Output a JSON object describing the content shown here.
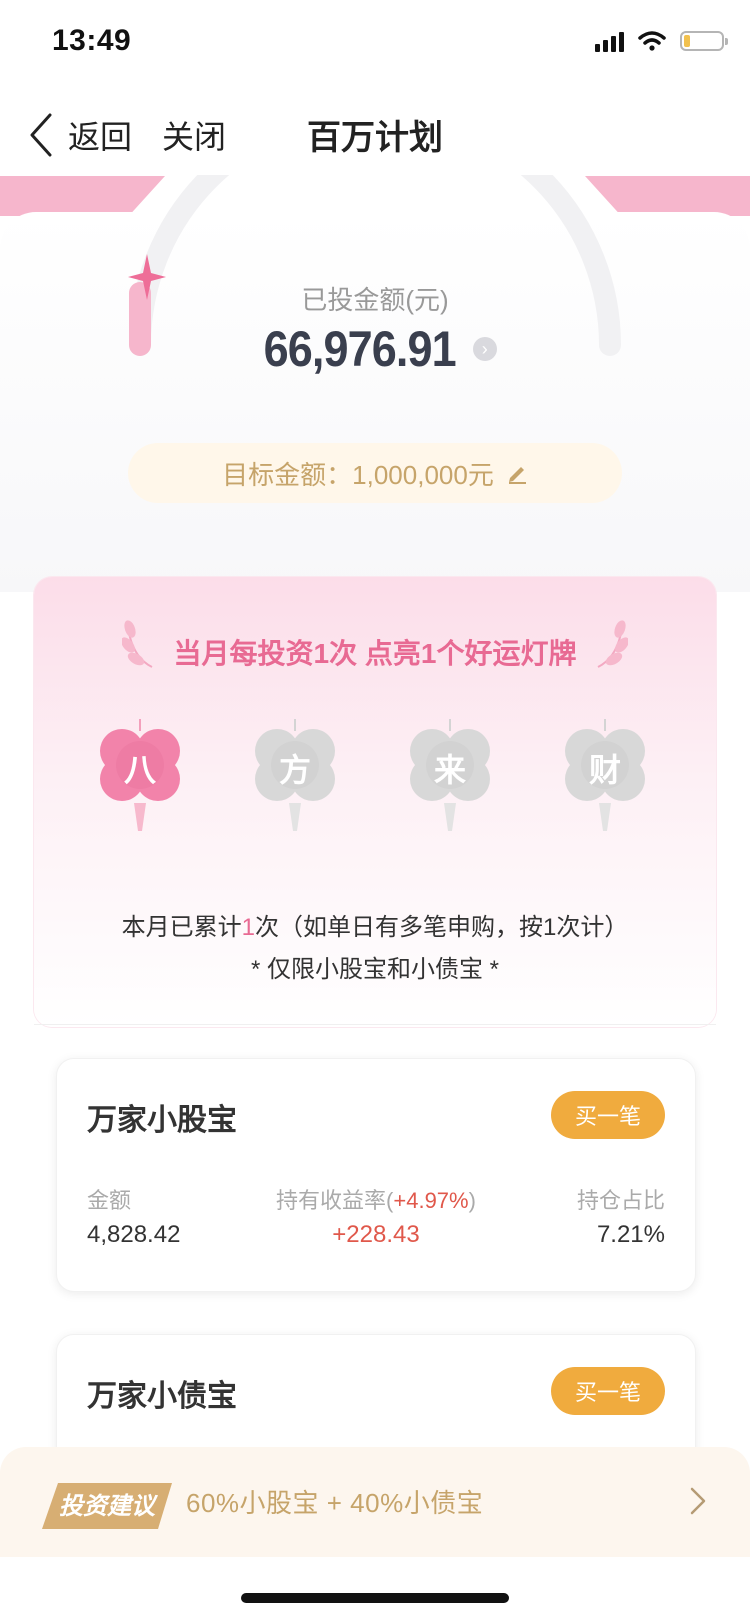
{
  "status_bar": {
    "time": "13:49"
  },
  "nav": {
    "back": "返回",
    "close": "关闭",
    "title": "百万计划"
  },
  "hero": {
    "amount_label": "已投金额(元)",
    "amount_value": "66,976.91",
    "target_text": "目标金额：1,000,000元"
  },
  "lucky": {
    "title": "当月每投资1次 点亮1个好运灯牌",
    "clovers": [
      {
        "char": "八",
        "lit": true
      },
      {
        "char": "方",
        "lit": false
      },
      {
        "char": "来",
        "lit": false
      },
      {
        "char": "财",
        "lit": false
      }
    ],
    "count_prefix": "本月已累计",
    "count_value": "1",
    "count_suffix": "次（如单日有多笔申购，按1次计）",
    "limit_text": "* 仅限小股宝和小债宝 *"
  },
  "products": [
    {
      "name": "万家小股宝",
      "buy_label": "买一笔",
      "amount_label": "金额",
      "amount_value": "4,828.42",
      "yield_label_prefix": "持有收益率(",
      "yield_rate": "+4.97%",
      "yield_label_suffix": ")",
      "yield_value": "+228.43",
      "ratio_label": "持仓占比",
      "ratio_value": "7.21%"
    },
    {
      "name": "万家小债宝",
      "buy_label": "买一笔"
    }
  ],
  "suggestion": {
    "badge": "投资建议",
    "text": "60%小股宝 + 40%小债宝"
  },
  "colors": {
    "accent_pink": "#e86a93",
    "buy_orange": "#f0ab3e",
    "gold_text": "#c6a46a",
    "gain_red": "#e0584b"
  }
}
